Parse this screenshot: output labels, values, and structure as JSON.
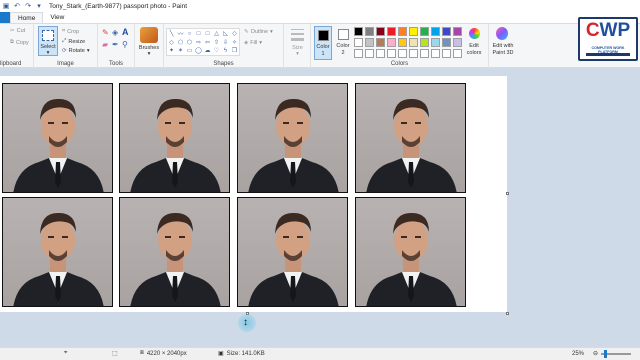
{
  "window": {
    "title": "Tony_Stark_(Earth-9877) passport photo - Paint"
  },
  "tabs": [
    {
      "label": "File"
    },
    {
      "label": "Home"
    },
    {
      "label": "View"
    }
  ],
  "clipboard": {
    "cut": "Cut",
    "copy": "Copy",
    "group_label": "lipboard"
  },
  "image": {
    "select": "Select",
    "crop": "Crop",
    "resize": "Resize",
    "rotate": "Rotate",
    "group_label": "Image"
  },
  "tools": {
    "group_label": "Tools"
  },
  "brushes": {
    "label": "Brushes"
  },
  "shapes": {
    "outline": "Outline",
    "fill": "Fill",
    "group_label": "Shapes",
    "glyphs": [
      "╲",
      "〰",
      "○",
      "□",
      "□",
      "△",
      "◺",
      "◇",
      "◇",
      "⬠",
      "⬡",
      "⇨",
      "⇦",
      "⇧",
      "⇩",
      "✧",
      "✦",
      "✶",
      "▭",
      "◯",
      "☁",
      "♡",
      "ϟ",
      "❒"
    ]
  },
  "size": {
    "label": "Size"
  },
  "colors": {
    "color1": "Color\n1",
    "color2": "Color\n2",
    "edit_colors": "Edit\ncolors",
    "edit_paint3d": "Edit with\nPaint 3D",
    "group_label": "Colors",
    "palette": [
      "#000000",
      "#7f7f7f",
      "#880015",
      "#ed1c24",
      "#ff7f27",
      "#fff200",
      "#22b14c",
      "#00a2e8",
      "#3f48cc",
      "#a349a4",
      "#ffffff",
      "#c3c3c3",
      "#b97a57",
      "#ffaec9",
      "#ffc90e",
      "#efe4b0",
      "#b5e61d",
      "#99d9ea",
      "#7092be",
      "#c8bfe7",
      "#ffffff",
      "#ffffff",
      "#ffffff",
      "#ffffff",
      "#ffffff",
      "#ffffff",
      "#ffffff",
      "#ffffff",
      "#ffffff",
      "#ffffff"
    ]
  },
  "logo": {
    "text_c": "C",
    "text_w": "W",
    "text_p": "P",
    "subtitle": "COMPUTER WORK PLATFORM"
  },
  "status": {
    "dimensions": "4220 × 2040px",
    "size": "Size: 141.0KB",
    "zoom": "25%"
  }
}
